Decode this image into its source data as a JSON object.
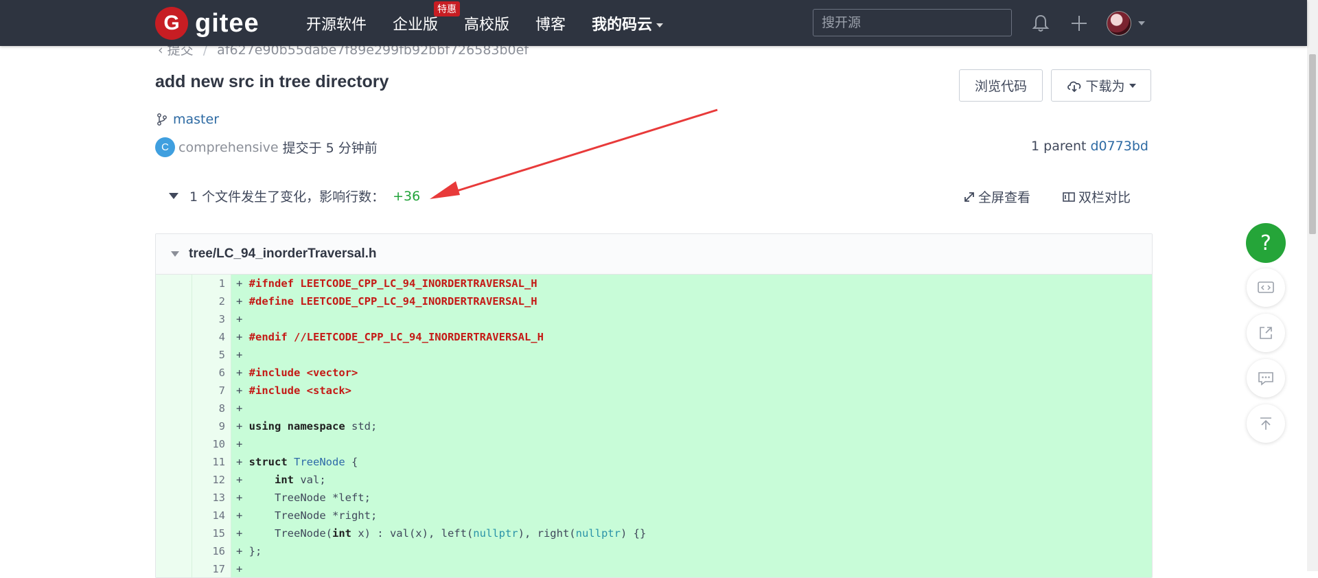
{
  "navbar": {
    "logo_text": "gitee",
    "logo_letter": "G",
    "items": [
      {
        "label": "开源软件"
      },
      {
        "label": "企业版",
        "badge": "特惠"
      },
      {
        "label": "高校版"
      },
      {
        "label": "博客"
      },
      {
        "label": "我的码云"
      }
    ],
    "search_placeholder": "搜开源"
  },
  "breadcrumb": {
    "back_label": "提交",
    "commit_hash": "af627e90b55dabe7f89e299fb92bbf726583b0ef"
  },
  "commit": {
    "title": "add new src in tree directory",
    "branch": "master",
    "author_initial": "C",
    "author": "comprehensive",
    "time": "提交于 5 分钟前",
    "parent_label": "1 parent",
    "parent_hash": "d0773bd"
  },
  "actions": {
    "browse_label": "浏览代码",
    "download_label": "下载为"
  },
  "changes": {
    "summary": "1 个文件发生了变化，影响行数：",
    "count": "+36",
    "fullscreen_label": "全屏查看",
    "split_label": "双栏对比"
  },
  "diff": {
    "file_name": "tree/LC_94_inorderTraversal.h",
    "lines": [
      {
        "n": "1"
      },
      {
        "n": "2"
      },
      {
        "n": "3"
      },
      {
        "n": "4"
      },
      {
        "n": "5"
      },
      {
        "n": "6"
      },
      {
        "n": "7"
      },
      {
        "n": "8"
      },
      {
        "n": "9"
      },
      {
        "n": "10"
      },
      {
        "n": "11"
      },
      {
        "n": "12"
      },
      {
        "n": "13"
      },
      {
        "n": "14"
      },
      {
        "n": "15"
      },
      {
        "n": "16"
      },
      {
        "n": "17"
      }
    ]
  },
  "floating": {
    "help_label": "?"
  },
  "colors": {
    "navbar_bg": "#2e3440",
    "brand_red": "#c71d23",
    "added_line_bg": "#c8fcd8",
    "help_green": "#25a539",
    "annotation_red": "#e83a3a"
  }
}
